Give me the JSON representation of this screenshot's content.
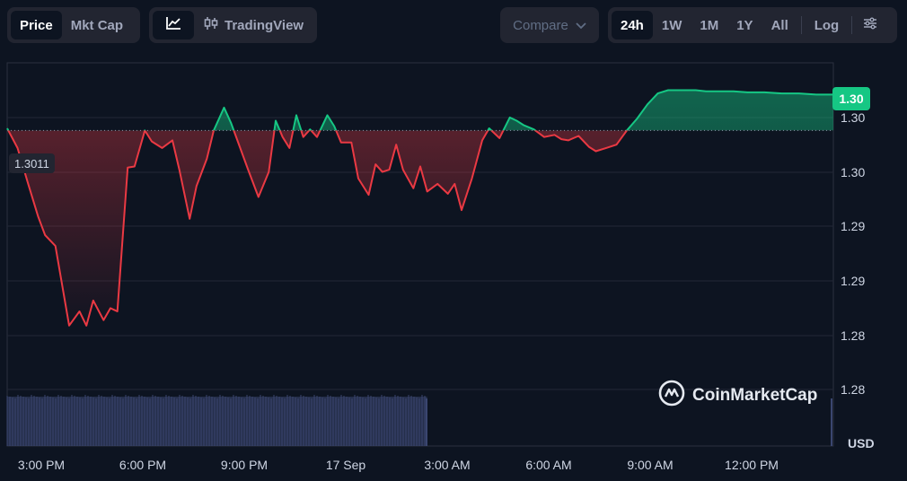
{
  "toolbar": {
    "view_tabs": [
      {
        "label": "Price",
        "active": true
      },
      {
        "label": "Mkt Cap",
        "active": false
      }
    ],
    "line_chart_icon": "line-chart-icon",
    "tradingview_label": "TradingView",
    "tradingview_icon": "candlestick-icon",
    "compare_label": "Compare",
    "ranges": [
      {
        "label": "24h",
        "active": true
      },
      {
        "label": "1W",
        "active": false
      },
      {
        "label": "1M",
        "active": false
      },
      {
        "label": "1Y",
        "active": false
      },
      {
        "label": "All",
        "active": false
      }
    ],
    "log_label": "Log",
    "settings_icon": "sliders-icon"
  },
  "chart": {
    "current_price_label": "1.30",
    "reference_price_label": "1.3011",
    "currency_unit": "USD",
    "watermark": "CoinMarketCap",
    "colors": {
      "up": "#16c784",
      "down": "#ea3943",
      "background": "#0d1421",
      "volume": "#3a4670"
    }
  },
  "chart_data": {
    "type": "area",
    "baseline": 1.3011,
    "y_tick_labels": [
      "1.30",
      "1.30",
      "1.29",
      "1.29",
      "1.28",
      "1.28"
    ],
    "x_tick_labels": [
      "3:00 PM",
      "6:00 PM",
      "9:00 PM",
      "17 Sep",
      "3:00 AM",
      "6:00 AM",
      "9:00 AM",
      "12:00 PM"
    ],
    "ylim": [
      1.2775,
      1.3055
    ],
    "x": [
      0,
      0.3,
      0.6,
      0.9,
      1.1,
      1.4,
      1.8,
      2.1,
      2.3,
      2.5,
      2.8,
      3.0,
      3.2,
      3.5,
      3.7,
      4.0,
      4.2,
      4.5,
      4.8,
      5.0,
      5.3,
      5.5,
      5.8,
      6.0,
      6.3,
      6.5,
      6.7,
      7.0,
      7.3,
      7.6,
      7.8,
      8.0,
      8.2,
      8.4,
      8.6,
      8.8,
      9.0,
      9.3,
      9.5,
      9.7,
      10.0,
      10.2,
      10.5,
      10.7,
      10.9,
      11.1,
      11.3,
      11.5,
      11.8,
      12.0,
      12.2,
      12.5,
      12.8,
      13.0,
      13.2,
      13.5,
      13.8,
      14.0,
      14.3,
      14.6,
      14.8,
      15.0,
      15.3,
      15.6,
      15.9,
      16.1,
      16.3,
      16.6,
      16.9,
      17.1,
      17.4,
      17.7,
      18.0,
      18.3,
      18.6,
      18.9,
      19.2,
      19.4,
      19.7,
      20.0,
      20.3,
      20.6,
      20.8,
      21.1,
      21.5,
      22.0,
      22.5,
      23.0,
      23.5,
      24.0
    ],
    "values": [
      1.3013,
      1.2995,
      1.2963,
      1.2932,
      1.2915,
      1.2905,
      1.2832,
      1.2845,
      1.2832,
      1.2855,
      1.2837,
      1.2848,
      1.2845,
      1.2977,
      1.2978,
      1.3011,
      1.3001,
      1.2995,
      1.3002,
      1.2975,
      1.293,
      1.296,
      1.2985,
      1.3011,
      1.3032,
      1.3018,
      1.3001,
      1.2975,
      1.295,
      1.2973,
      1.302,
      1.3005,
      1.2995,
      1.3025,
      1.3005,
      1.3012,
      1.3005,
      1.3025,
      1.3015,
      1.3,
      1.3,
      1.2967,
      1.2952,
      1.298,
      1.2973,
      1.2975,
      1.2998,
      1.2975,
      1.2958,
      1.2978,
      1.2955,
      1.2962,
      1.2953,
      1.2962,
      1.2938,
      1.2967,
      1.3002,
      1.3013,
      1.3004,
      1.3023,
      1.302,
      1.3016,
      1.3012,
      1.3005,
      1.3007,
      1.3003,
      1.3002,
      1.3006,
      1.2996,
      1.2992,
      1.2995,
      1.2998,
      1.3011,
      1.3022,
      1.3035,
      1.3045,
      1.3048,
      1.3048,
      1.3048,
      1.3048,
      1.3047,
      1.3047,
      1.3047,
      1.3047,
      1.3046,
      1.3046,
      1.3045,
      1.3045,
      1.3044,
      1.3044
    ],
    "volume_end_x": 12.2
  }
}
